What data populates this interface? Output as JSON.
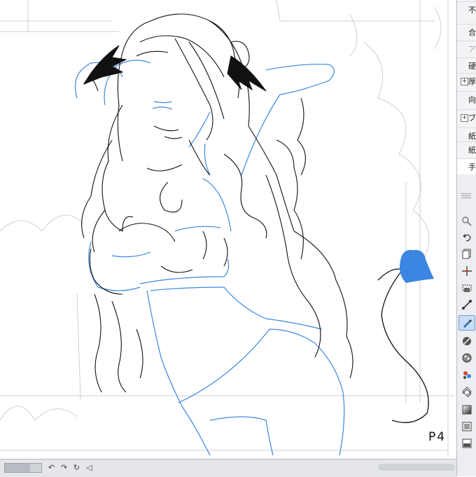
{
  "canvas": {
    "page_label": "P4"
  },
  "properties_panel": {
    "rows": [
      {
        "label": "不",
        "expandable": false,
        "dim": false
      },
      {
        "label": "合",
        "expandable": false,
        "dim": false
      },
      {
        "label": "ア",
        "expandable": false,
        "dim": true
      },
      {
        "label": "硬",
        "expandable": false,
        "dim": false
      },
      {
        "label": "厚",
        "expandable": true,
        "dim": false
      },
      {
        "label": "向",
        "expandable": false,
        "dim": false
      },
      {
        "label": "ブ",
        "expandable": true,
        "dim": false
      },
      {
        "label": "紙",
        "expandable": false,
        "dim": false
      },
      {
        "label": "紙",
        "expandable": false,
        "dim": false
      },
      {
        "label": "手",
        "expandable": false,
        "dim": false
      }
    ]
  },
  "toolbar": {
    "tools": [
      {
        "icon": "magnifier-icon",
        "active": false
      },
      {
        "icon": "undo-icon",
        "active": false
      },
      {
        "icon": "layer-copy-icon",
        "active": false
      },
      {
        "icon": "move-layer-icon",
        "active": false
      },
      {
        "icon": "select-icon",
        "active": false
      },
      {
        "icon": "operation-icon",
        "active": false
      },
      {
        "icon": "pen-icon",
        "active": true
      },
      {
        "icon": "pencil-icon",
        "active": false
      },
      {
        "icon": "brush-icon",
        "active": false
      },
      {
        "icon": "decoration-icon",
        "active": false
      },
      {
        "icon": "eraser-icon",
        "active": false
      },
      {
        "icon": "fill-icon",
        "active": false
      },
      {
        "icon": "gradient-icon",
        "active": false
      },
      {
        "icon": "figure-icon",
        "active": false
      },
      {
        "icon": "frame-icon",
        "active": false
      }
    ]
  },
  "bottom_bar": {
    "zoom_level": 0.7
  },
  "colors": {
    "sketch_blue": "#3a86e0",
    "lineart": "#111111",
    "border_gray": "#c9c9c9",
    "active_tool": "#c9dcf2"
  }
}
